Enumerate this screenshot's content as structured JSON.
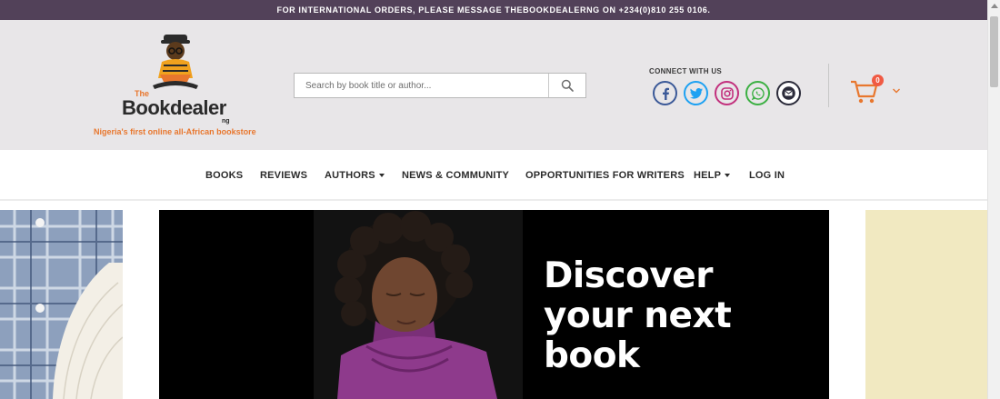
{
  "topbar": {
    "text": "FOR INTERNATIONAL ORDERS, PLEASE MESSAGE THEBOOKDEALERNG ON +234(0)810 255 0106."
  },
  "logo": {
    "the": "The",
    "book": "Bookdealer",
    "ng": "ng"
  },
  "tagline": "Nigeria's first online all-African bookstore",
  "search": {
    "placeholder": "Search by book title or author..."
  },
  "connect": {
    "label": "CONNECT WITH US",
    "icons": [
      "facebook-icon",
      "twitter-icon",
      "instagram-icon",
      "whatsapp-icon",
      "email-icon"
    ]
  },
  "cart": {
    "count": "0"
  },
  "nav": {
    "books": "BOOKS",
    "reviews": "REVIEWS",
    "authors": "AUTHORS",
    "news": "NEWS & COMMUNITY",
    "opportunities": "OPPORTUNITIES FOR WRITERS",
    "help": "HELP",
    "login": "LOG IN"
  },
  "banner": {
    "line1": "Discover",
    "line2": "your next",
    "line3": "book"
  },
  "colors": {
    "topbar": "#524159",
    "accent": "#e8772e",
    "header_bg": "#e8e6e8",
    "badge": "#f05a43"
  }
}
